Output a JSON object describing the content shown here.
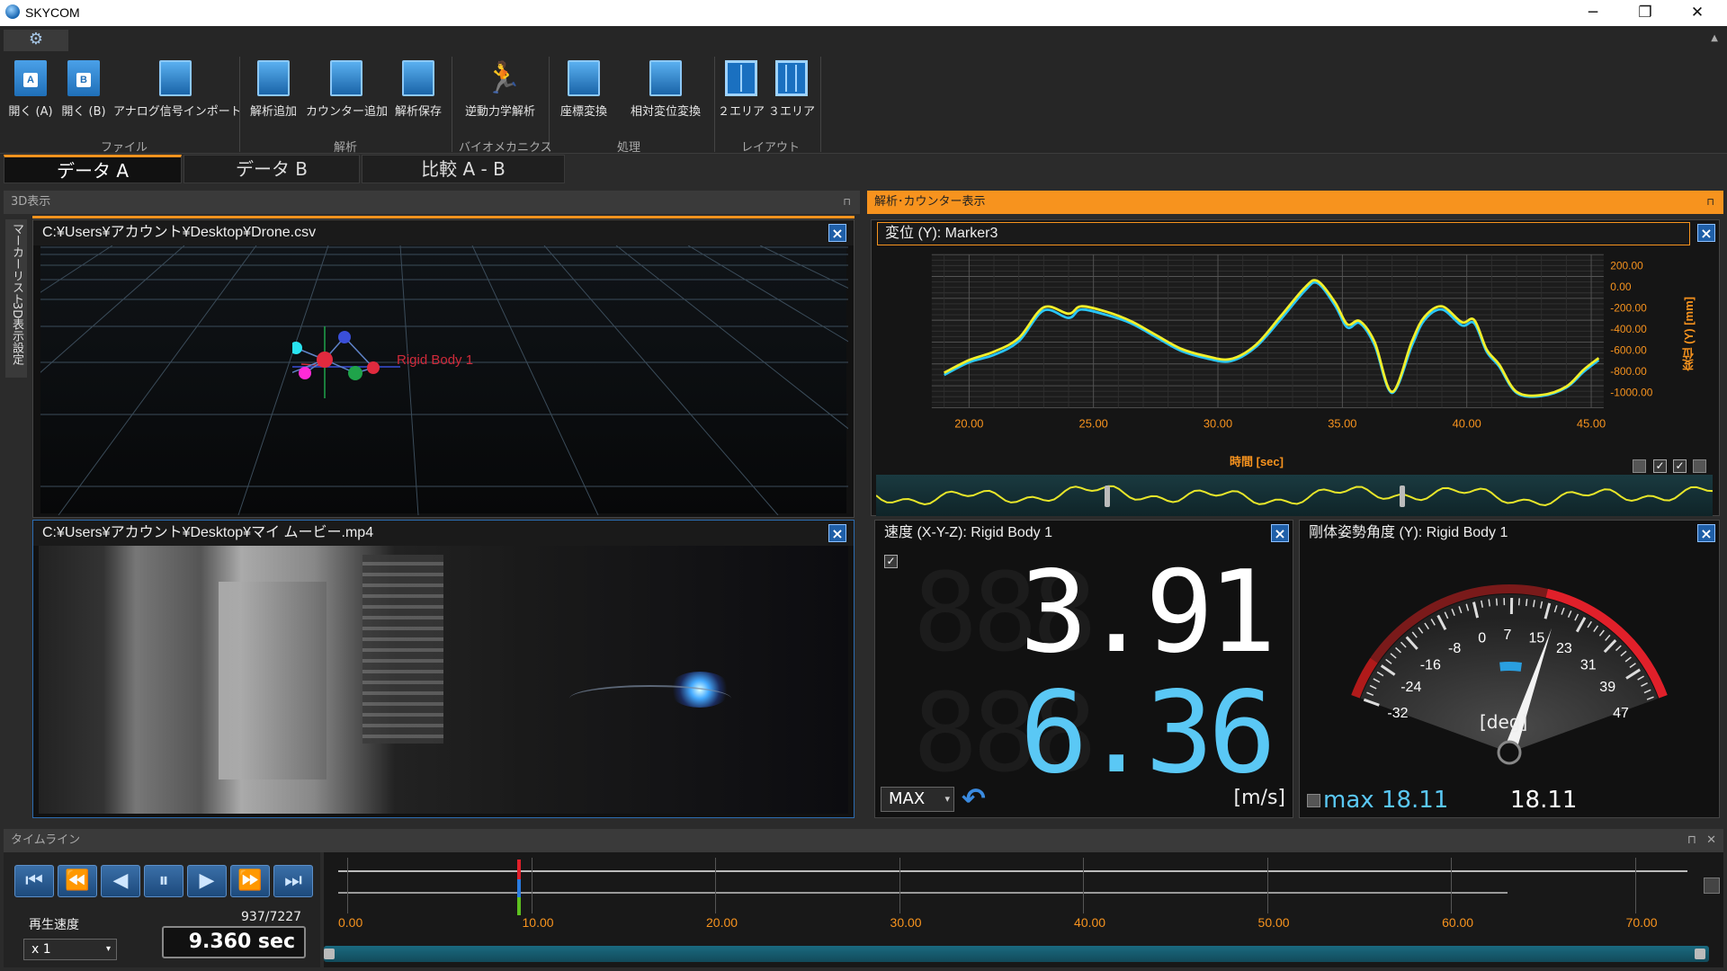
{
  "app": {
    "title": "SKYCOM"
  },
  "window_controls": {
    "minimize": "─",
    "maximize": "❐",
    "close": "✕"
  },
  "ribbon": {
    "settings_icon": "⚙",
    "buttons": [
      {
        "label": "開く (A)",
        "icon": "open-a-icon",
        "badge": "A"
      },
      {
        "label": "開く (B)",
        "icon": "open-b-icon",
        "badge": "B"
      },
      {
        "label": "アナログ信号インポート",
        "icon": "import-icon"
      },
      {
        "label": "解析追加",
        "icon": "add-analysis-icon"
      },
      {
        "label": "カウンター追加",
        "icon": "add-counter-icon"
      },
      {
        "label": "解析保存",
        "icon": "save-analysis-icon"
      },
      {
        "label": "逆動力学解析",
        "icon": "inverse-dynamics-icon"
      },
      {
        "label": "座標変換",
        "icon": "coordinate-transform-icon"
      },
      {
        "label": "相対変位変換",
        "icon": "relative-displacement-icon"
      },
      {
        "label": "２エリア",
        "icon": "two-area-layout-icon"
      },
      {
        "label": "３エリア",
        "icon": "three-area-layout-icon"
      }
    ],
    "groups": [
      "ファイル",
      "解析",
      "バイオメカニクス",
      "処理",
      "レイアウト"
    ]
  },
  "tabs": [
    {
      "label": "データ A",
      "active": true
    },
    {
      "label": "データ B",
      "active": false
    },
    {
      "label": "比較 A - B",
      "active": false
    }
  ],
  "left_panel": {
    "title": "3D表示",
    "pin": "⊓",
    "side_tabs": [
      "マーカーリスト",
      "3D表示設定"
    ],
    "view3d": {
      "path": "C:¥Users¥アカウント¥Desktop¥Drone.csv",
      "rigid_body_label": "Rigid Body 1"
    },
    "video": {
      "path": "C:¥Users¥アカウント¥Desktop¥マイ ムービー.mp4"
    }
  },
  "right_panel": {
    "title": "解析･カウンター表示",
    "pin": "⊓",
    "chart_title": "変位 (Y):  Marker3",
    "speed": {
      "title": "速度 (X-Y-Z):  Rigid Body 1",
      "value_top": "3.91",
      "value_bottom": "6.36",
      "unit": "[m/s]",
      "mode": "MAX",
      "checkbox": "✓",
      "reset_icon": "↶"
    },
    "gauge": {
      "title": "剛体姿勢角度 (Y):  Rigid Body 1",
      "unit": "[deg]",
      "max_label": "max 18.11",
      "value_label": "18.11",
      "value": 18.11,
      "min": -32,
      "max": 47,
      "ticks": [
        "-32",
        "-24",
        "-16",
        "-8",
        "0",
        "7",
        "15",
        "23",
        "31",
        "39",
        "47"
      ]
    },
    "checkboxes": [
      "",
      "✓",
      "✓",
      ""
    ]
  },
  "chart_data": {
    "type": "line",
    "title": "変位 (Y):  Marker3",
    "xlabel": "時間 [sec]",
    "ylabel": "変位 (Y) [mm]",
    "xlim": [
      18.5,
      45.5
    ],
    "ylim": [
      -1150,
      300
    ],
    "x_ticks": [
      "20.00",
      "25.00",
      "30.00",
      "35.00",
      "40.00",
      "45.00"
    ],
    "y_ticks": [
      "200.00",
      "0.00",
      "-200.00",
      "-400.00",
      "-600.00",
      "-800.00",
      "-1000.00"
    ],
    "series": [
      {
        "color": "#29c5f6",
        "x": [
          19.0,
          20.0,
          21.0,
          22.0,
          23.0,
          24.0,
          24.5,
          25.5,
          26.5,
          27.5,
          28.5,
          29.5,
          30.5,
          31.5,
          32.5,
          33.5,
          34.0,
          34.7,
          35.2,
          35.7,
          36.3,
          37.0,
          37.8,
          38.3,
          39.0,
          39.8,
          40.3,
          40.8,
          41.3,
          42.0,
          43.0,
          44.0,
          44.7,
          45.3
        ],
        "y": [
          -840,
          -720,
          -650,
          -520,
          -230,
          -300,
          -220,
          -270,
          -350,
          -480,
          -610,
          -680,
          -710,
          -580,
          -320,
          -40,
          30,
          -180,
          -390,
          -350,
          -560,
          -1010,
          -560,
          -320,
          -220,
          -370,
          -350,
          -620,
          -760,
          -1010,
          -1040,
          -960,
          -810,
          -700
        ]
      },
      {
        "color": "#f2ef2a",
        "x": [
          19.0,
          20.0,
          21.0,
          22.0,
          23.0,
          24.0,
          24.5,
          25.5,
          26.5,
          27.5,
          28.5,
          29.5,
          30.5,
          31.5,
          32.5,
          33.5,
          34.0,
          34.7,
          35.2,
          35.7,
          36.3,
          37.0,
          37.8,
          38.3,
          39.0,
          39.8,
          40.3,
          40.8,
          41.3,
          42.0,
          43.0,
          44.0,
          44.7,
          45.3
        ],
        "y": [
          -820,
          -700,
          -620,
          -490,
          -200,
          -260,
          -190,
          -240,
          -330,
          -460,
          -590,
          -660,
          -690,
          -560,
          -290,
          -10,
          50,
          -150,
          -360,
          -330,
          -530,
          -1000,
          -520,
          -290,
          -190,
          -340,
          -320,
          -600,
          -740,
          -1000,
          -1030,
          -950,
          -790,
          -680
        ]
      }
    ]
  },
  "timeline": {
    "title": "タイムライン",
    "pin": "⊓",
    "close": "✕",
    "speed_label": "再生速度",
    "speed_value": "x 1",
    "frame": "937/7227",
    "time": "9.360 sec",
    "controls": [
      "⏮",
      "⏪",
      "◀",
      "⏸",
      "▶",
      "⏩",
      "⏭"
    ],
    "x_labels": [
      "0.00",
      "10.00",
      "20.00",
      "30.00",
      "40.00",
      "50.00",
      "60.00",
      "70.00"
    ],
    "cursor_value": 9.36,
    "range_max": 72.27
  }
}
